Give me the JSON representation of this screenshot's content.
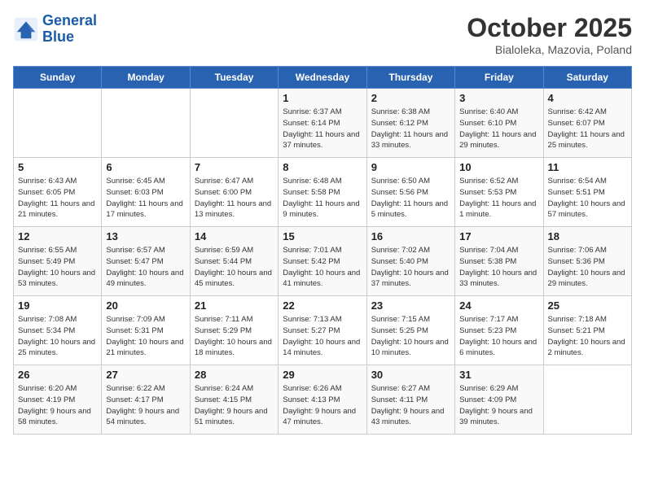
{
  "logo": {
    "line1": "General",
    "line2": "Blue"
  },
  "title": "October 2025",
  "subtitle": "Bialoleka, Mazovia, Poland",
  "days_of_week": [
    "Sunday",
    "Monday",
    "Tuesday",
    "Wednesday",
    "Thursday",
    "Friday",
    "Saturday"
  ],
  "weeks": [
    [
      {
        "day": "",
        "sunrise": "",
        "sunset": "",
        "daylight": ""
      },
      {
        "day": "",
        "sunrise": "",
        "sunset": "",
        "daylight": ""
      },
      {
        "day": "",
        "sunrise": "",
        "sunset": "",
        "daylight": ""
      },
      {
        "day": "1",
        "sunrise": "Sunrise: 6:37 AM",
        "sunset": "Sunset: 6:14 PM",
        "daylight": "Daylight: 11 hours and 37 minutes."
      },
      {
        "day": "2",
        "sunrise": "Sunrise: 6:38 AM",
        "sunset": "Sunset: 6:12 PM",
        "daylight": "Daylight: 11 hours and 33 minutes."
      },
      {
        "day": "3",
        "sunrise": "Sunrise: 6:40 AM",
        "sunset": "Sunset: 6:10 PM",
        "daylight": "Daylight: 11 hours and 29 minutes."
      },
      {
        "day": "4",
        "sunrise": "Sunrise: 6:42 AM",
        "sunset": "Sunset: 6:07 PM",
        "daylight": "Daylight: 11 hours and 25 minutes."
      }
    ],
    [
      {
        "day": "5",
        "sunrise": "Sunrise: 6:43 AM",
        "sunset": "Sunset: 6:05 PM",
        "daylight": "Daylight: 11 hours and 21 minutes."
      },
      {
        "day": "6",
        "sunrise": "Sunrise: 6:45 AM",
        "sunset": "Sunset: 6:03 PM",
        "daylight": "Daylight: 11 hours and 17 minutes."
      },
      {
        "day": "7",
        "sunrise": "Sunrise: 6:47 AM",
        "sunset": "Sunset: 6:00 PM",
        "daylight": "Daylight: 11 hours and 13 minutes."
      },
      {
        "day": "8",
        "sunrise": "Sunrise: 6:48 AM",
        "sunset": "Sunset: 5:58 PM",
        "daylight": "Daylight: 11 hours and 9 minutes."
      },
      {
        "day": "9",
        "sunrise": "Sunrise: 6:50 AM",
        "sunset": "Sunset: 5:56 PM",
        "daylight": "Daylight: 11 hours and 5 minutes."
      },
      {
        "day": "10",
        "sunrise": "Sunrise: 6:52 AM",
        "sunset": "Sunset: 5:53 PM",
        "daylight": "Daylight: 11 hours and 1 minute."
      },
      {
        "day": "11",
        "sunrise": "Sunrise: 6:54 AM",
        "sunset": "Sunset: 5:51 PM",
        "daylight": "Daylight: 10 hours and 57 minutes."
      }
    ],
    [
      {
        "day": "12",
        "sunrise": "Sunrise: 6:55 AM",
        "sunset": "Sunset: 5:49 PM",
        "daylight": "Daylight: 10 hours and 53 minutes."
      },
      {
        "day": "13",
        "sunrise": "Sunrise: 6:57 AM",
        "sunset": "Sunset: 5:47 PM",
        "daylight": "Daylight: 10 hours and 49 minutes."
      },
      {
        "day": "14",
        "sunrise": "Sunrise: 6:59 AM",
        "sunset": "Sunset: 5:44 PM",
        "daylight": "Daylight: 10 hours and 45 minutes."
      },
      {
        "day": "15",
        "sunrise": "Sunrise: 7:01 AM",
        "sunset": "Sunset: 5:42 PM",
        "daylight": "Daylight: 10 hours and 41 minutes."
      },
      {
        "day": "16",
        "sunrise": "Sunrise: 7:02 AM",
        "sunset": "Sunset: 5:40 PM",
        "daylight": "Daylight: 10 hours and 37 minutes."
      },
      {
        "day": "17",
        "sunrise": "Sunrise: 7:04 AM",
        "sunset": "Sunset: 5:38 PM",
        "daylight": "Daylight: 10 hours and 33 minutes."
      },
      {
        "day": "18",
        "sunrise": "Sunrise: 7:06 AM",
        "sunset": "Sunset: 5:36 PM",
        "daylight": "Daylight: 10 hours and 29 minutes."
      }
    ],
    [
      {
        "day": "19",
        "sunrise": "Sunrise: 7:08 AM",
        "sunset": "Sunset: 5:34 PM",
        "daylight": "Daylight: 10 hours and 25 minutes."
      },
      {
        "day": "20",
        "sunrise": "Sunrise: 7:09 AM",
        "sunset": "Sunset: 5:31 PM",
        "daylight": "Daylight: 10 hours and 21 minutes."
      },
      {
        "day": "21",
        "sunrise": "Sunrise: 7:11 AM",
        "sunset": "Sunset: 5:29 PM",
        "daylight": "Daylight: 10 hours and 18 minutes."
      },
      {
        "day": "22",
        "sunrise": "Sunrise: 7:13 AM",
        "sunset": "Sunset: 5:27 PM",
        "daylight": "Daylight: 10 hours and 14 minutes."
      },
      {
        "day": "23",
        "sunrise": "Sunrise: 7:15 AM",
        "sunset": "Sunset: 5:25 PM",
        "daylight": "Daylight: 10 hours and 10 minutes."
      },
      {
        "day": "24",
        "sunrise": "Sunrise: 7:17 AM",
        "sunset": "Sunset: 5:23 PM",
        "daylight": "Daylight: 10 hours and 6 minutes."
      },
      {
        "day": "25",
        "sunrise": "Sunrise: 7:18 AM",
        "sunset": "Sunset: 5:21 PM",
        "daylight": "Daylight: 10 hours and 2 minutes."
      }
    ],
    [
      {
        "day": "26",
        "sunrise": "Sunrise: 6:20 AM",
        "sunset": "Sunset: 4:19 PM",
        "daylight": "Daylight: 9 hours and 58 minutes."
      },
      {
        "day": "27",
        "sunrise": "Sunrise: 6:22 AM",
        "sunset": "Sunset: 4:17 PM",
        "daylight": "Daylight: 9 hours and 54 minutes."
      },
      {
        "day": "28",
        "sunrise": "Sunrise: 6:24 AM",
        "sunset": "Sunset: 4:15 PM",
        "daylight": "Daylight: 9 hours and 51 minutes."
      },
      {
        "day": "29",
        "sunrise": "Sunrise: 6:26 AM",
        "sunset": "Sunset: 4:13 PM",
        "daylight": "Daylight: 9 hours and 47 minutes."
      },
      {
        "day": "30",
        "sunrise": "Sunrise: 6:27 AM",
        "sunset": "Sunset: 4:11 PM",
        "daylight": "Daylight: 9 hours and 43 minutes."
      },
      {
        "day": "31",
        "sunrise": "Sunrise: 6:29 AM",
        "sunset": "Sunset: 4:09 PM",
        "daylight": "Daylight: 9 hours and 39 minutes."
      },
      {
        "day": "",
        "sunrise": "",
        "sunset": "",
        "daylight": ""
      }
    ]
  ]
}
